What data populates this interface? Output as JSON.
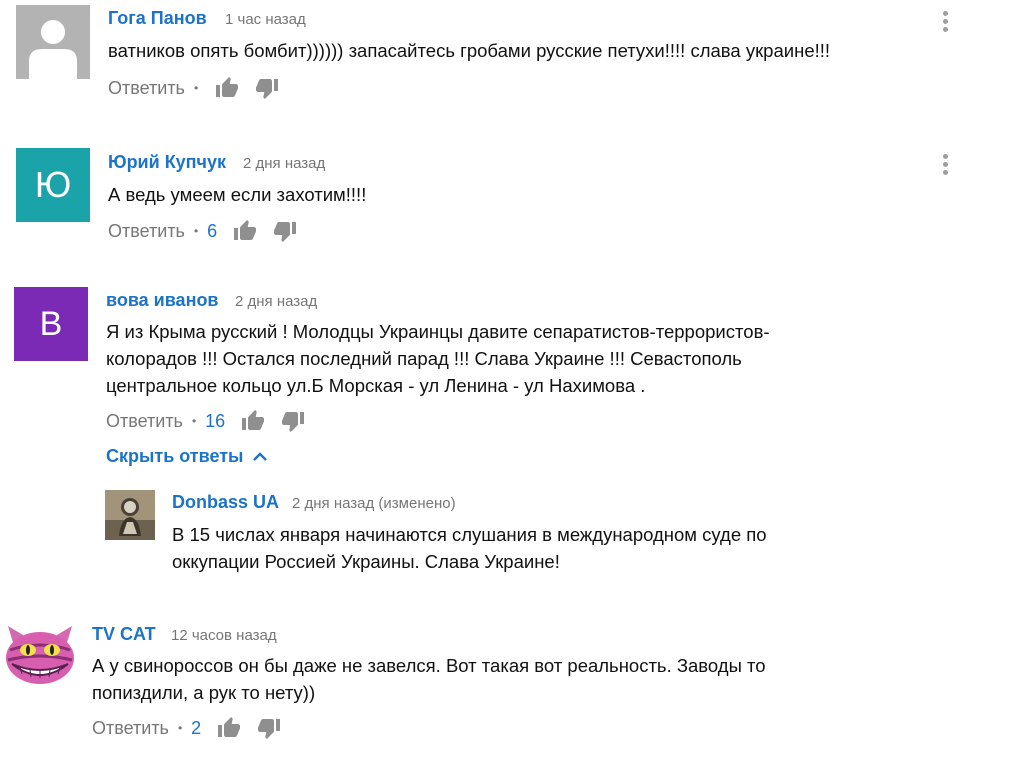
{
  "colors": {
    "author_link": "#1c73c8",
    "meta_gray": "#767676",
    "avatar_teal": "#1aa3a9",
    "avatar_purple": "#7b2ab5",
    "avatar_gray": "#b3b3b3"
  },
  "ui": {
    "reply_label": "Ответить",
    "hide_replies_label": "Скрыть ответы",
    "thumb_up_icon": "thumb-up-icon",
    "thumb_down_icon": "thumb-down-icon",
    "menu_icon": "more-vert-icon"
  },
  "comments": [
    {
      "author": "Гога Панов",
      "time": "1 час назад",
      "text": "ватников опять бомбит)))))) запасайтесь гробами русские петухи!!!! слава украине!!!",
      "likes": "",
      "avatar": "default-user-icon"
    },
    {
      "author": "Юрий Купчук",
      "time": "2 дня назад",
      "text": "А ведь умеем если захотим!!!!",
      "likes": "6",
      "avatar_letter": "Ю"
    },
    {
      "author": "вова иванов",
      "time": "2 дня назад",
      "text_lines": [
        "Я из Крыма русский  ! Молодцы Украинцы давите сепаратистов-террористов-",
        "колорадов !!! Остался последний парад !!! Слава Украине !!! Севастополь",
        "центральное кольцо ул.Б Морская - ул Ленина - ул Нахимова ."
      ],
      "likes": "16",
      "avatar_letter": "В"
    },
    {
      "author": "TV CAT",
      "time": "12 часов назад",
      "text_lines": [
        "А у свинороссов он бы даже не завелся. Вот такая вот реальность. Заводы то",
        "попиздили, а рук то нету))"
      ],
      "likes": "2",
      "avatar": "cheshire-cat-avatar"
    }
  ],
  "reply": {
    "author": "Donbass UA",
    "time": "2 дня назад (изменено)",
    "text_lines": [
      "В 15 числах января начинаются слушания в международном суде по",
      "оккупации Россией Украины. Слава Украине!"
    ],
    "avatar": "photo-avatar"
  }
}
